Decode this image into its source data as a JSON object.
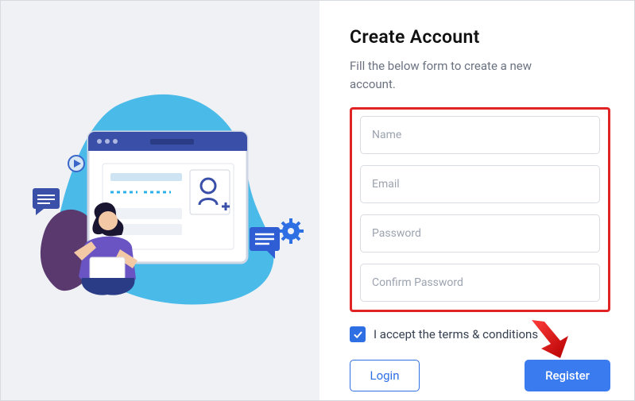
{
  "title": "Create Account",
  "subtitle": "Fill the below form to create a new account.",
  "fields": {
    "name": {
      "placeholder": "Name",
      "value": ""
    },
    "email": {
      "placeholder": "Email",
      "value": ""
    },
    "password": {
      "placeholder": "Password",
      "value": ""
    },
    "confirm": {
      "placeholder": "Confirm Password",
      "value": ""
    }
  },
  "terms": {
    "checked": true,
    "label": "I accept the terms & conditions"
  },
  "buttons": {
    "login": "Login",
    "register": "Register"
  },
  "colors": {
    "accent": "#3a7bf0",
    "highlight_border": "#e02424",
    "arrow": "#e02424"
  }
}
